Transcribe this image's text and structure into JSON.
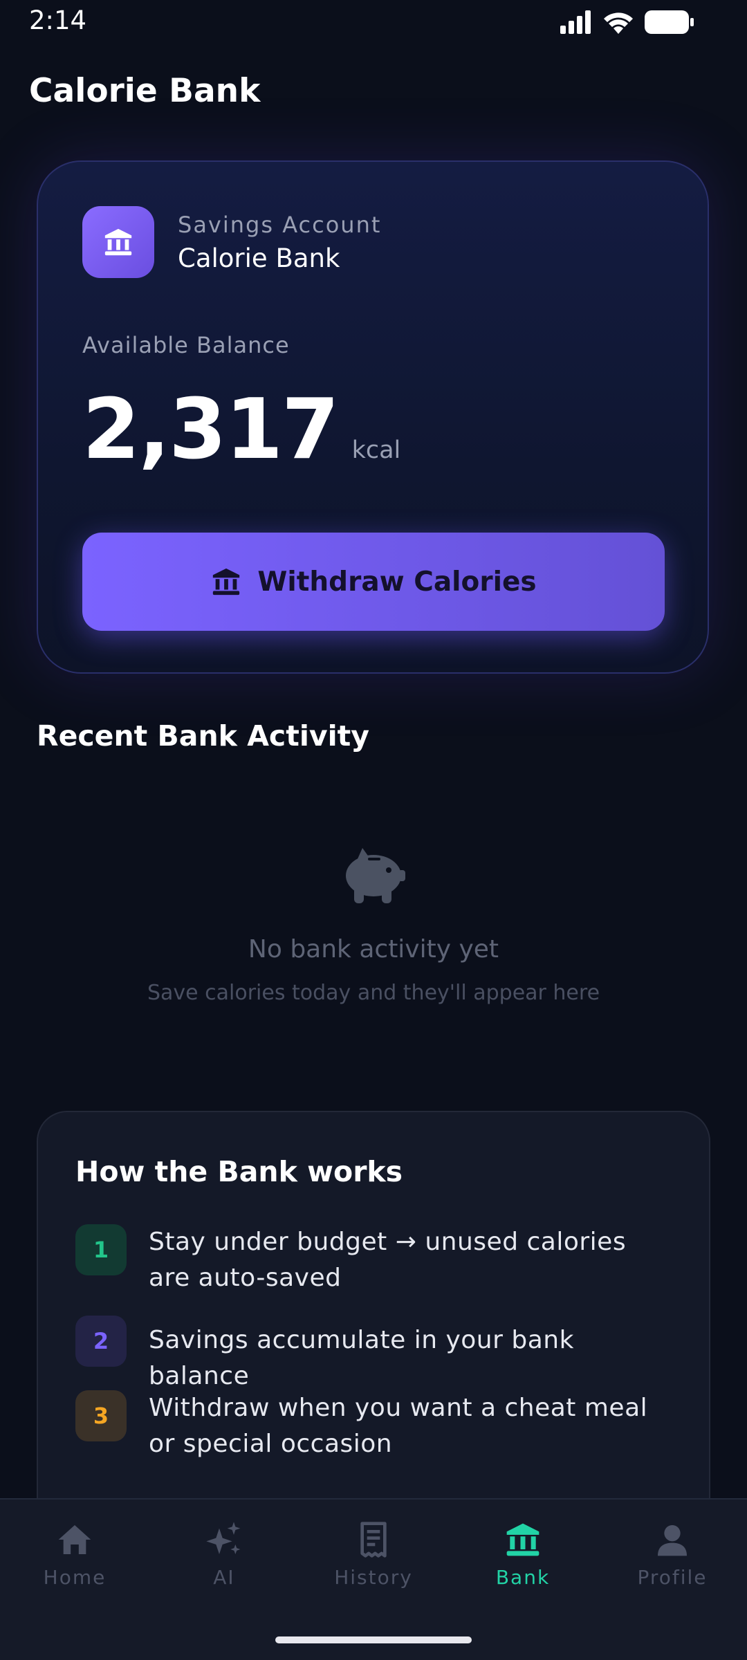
{
  "status_bar": {
    "time": "2:14"
  },
  "header": {
    "title": "Calorie Bank"
  },
  "bank_card": {
    "account_type": "Savings Account",
    "account_name": "Calorie Bank",
    "balance_label": "Available Balance",
    "balance_value": "2,317",
    "balance_unit": "kcal",
    "withdraw_label": "Withdraw Calories",
    "badge_icon": "bank-icon"
  },
  "activity": {
    "title": "Recent Bank Activity",
    "empty_icon": "piggy-bank-icon",
    "empty_title": "No bank activity yet",
    "empty_subtitle": "Save calories today and they'll appear here"
  },
  "how_it_works": {
    "title": "How the Bank works",
    "steps": [
      {
        "number": "1",
        "text": "Stay under budget → unused calories are auto-saved",
        "color": "#22c58a",
        "bg": "#123a32"
      },
      {
        "number": "2",
        "text": "Savings accumulate in your bank balance",
        "color": "#7b63ff",
        "bg": "#232346"
      },
      {
        "number": "3",
        "text": "Withdraw when you want a cheat meal or special occasion",
        "color": "#f5a623",
        "bg": "#3a3128"
      }
    ]
  },
  "bottom_nav": {
    "items": [
      {
        "label": "Home",
        "icon": "home-icon",
        "active": false
      },
      {
        "label": "AI",
        "icon": "sparkle-icon",
        "active": false
      },
      {
        "label": "History",
        "icon": "receipt-icon",
        "active": false
      },
      {
        "label": "Bank",
        "icon": "bank-icon",
        "active": true
      },
      {
        "label": "Profile",
        "icon": "person-icon",
        "active": false
      }
    ]
  },
  "colors": {
    "background": "#0b0f1b",
    "accent": "#7b63ff",
    "active_nav": "#22d3a6"
  }
}
